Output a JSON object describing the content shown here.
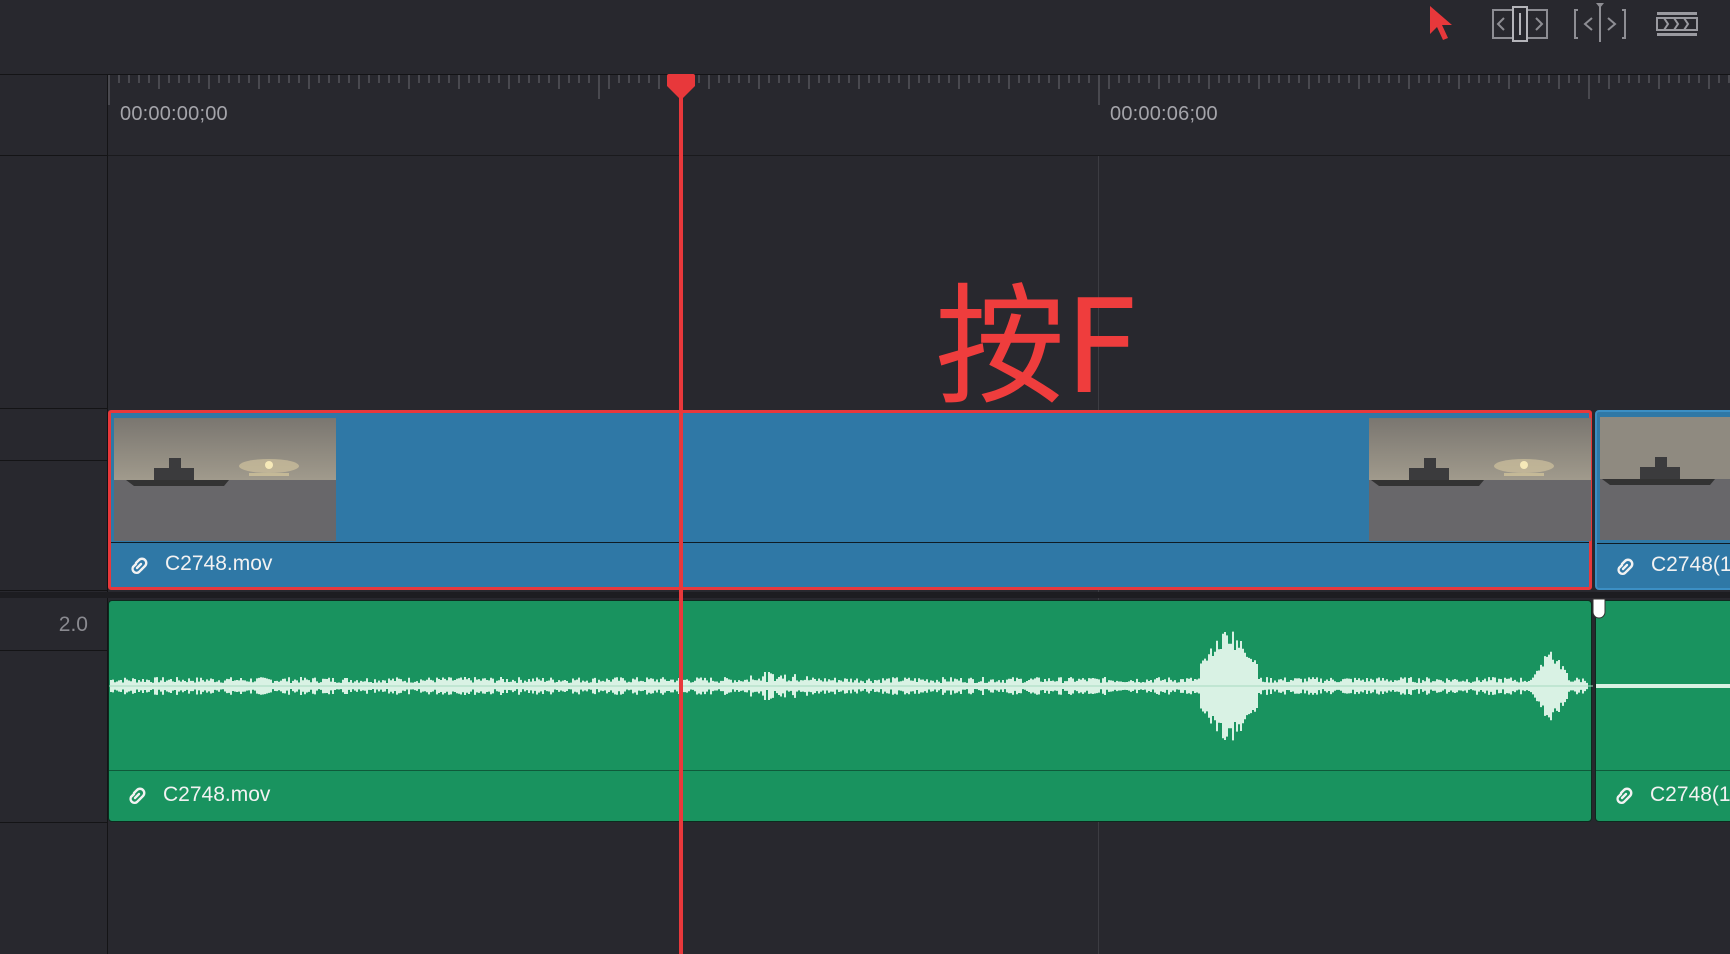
{
  "toolbar": {
    "tools": [
      {
        "icon": "selection-arrow-icon",
        "active": true
      },
      {
        "icon": "trim-edit-icon",
        "active": false
      },
      {
        "icon": "dynamic-trim-icon",
        "active": false
      },
      {
        "icon": "blade-icon",
        "active": false
      }
    ],
    "accent_color": "#e8383b"
  },
  "ruler": {
    "timecodes": [
      "00:00:00;00",
      "00:00:06;00"
    ]
  },
  "overlay": {
    "text": "按F"
  },
  "tracks": {
    "audio_level": "2.0",
    "video": {
      "clip_name": "C2748.mov",
      "next_clip_name": "C2748(1",
      "color": "#2f78a6",
      "selected": true
    },
    "audio": {
      "clip_name": "C2748.mov",
      "next_clip_name": "C2748(1",
      "color": "#19935f"
    }
  },
  "colors": {
    "background": "#28282e",
    "playhead": "#e8383b",
    "selection_border": "#e8383b"
  }
}
